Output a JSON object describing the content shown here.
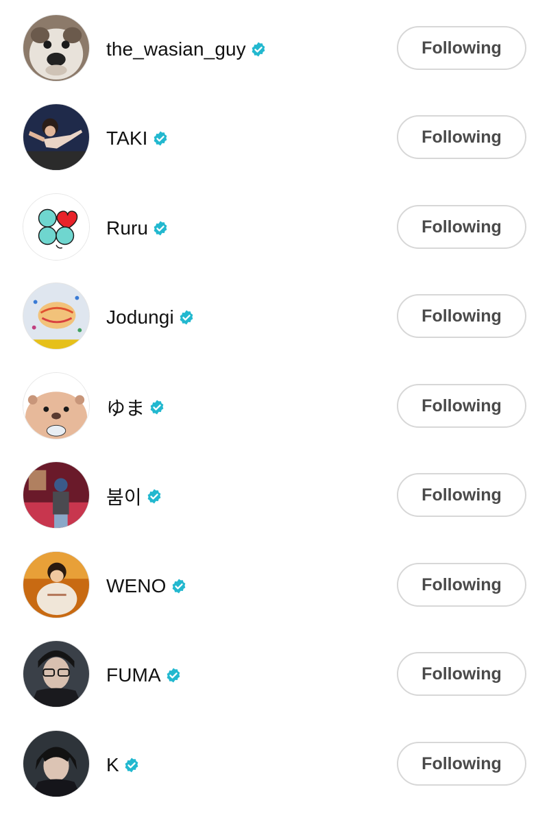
{
  "accent_color": "#22b8cf",
  "users": [
    {
      "username": "the_wasian_guy",
      "verified": true,
      "avatar": "dog-photo",
      "button_label": "Following"
    },
    {
      "username": "TAKI",
      "verified": true,
      "avatar": "child-dancer-photo",
      "button_label": "Following"
    },
    {
      "username": "Ruru",
      "verified": true,
      "avatar": "clover-hearts-drawing",
      "button_label": "Following"
    },
    {
      "username": "Jodungi",
      "verified": true,
      "avatar": "crayon-drawing",
      "button_label": "Following"
    },
    {
      "username": "ゆま",
      "verified": true,
      "avatar": "otter-cartoon",
      "button_label": "Following"
    },
    {
      "username": "붐이",
      "verified": true,
      "avatar": "stage-person-photo",
      "button_label": "Following"
    },
    {
      "username": "WENO",
      "verified": true,
      "avatar": "toddler-photo",
      "button_label": "Following"
    },
    {
      "username": "FUMA",
      "verified": true,
      "avatar": "man-with-glasses-photo",
      "button_label": "Following"
    },
    {
      "username": "K",
      "verified": true,
      "avatar": "man-portrait-photo",
      "button_label": "Following"
    }
  ]
}
